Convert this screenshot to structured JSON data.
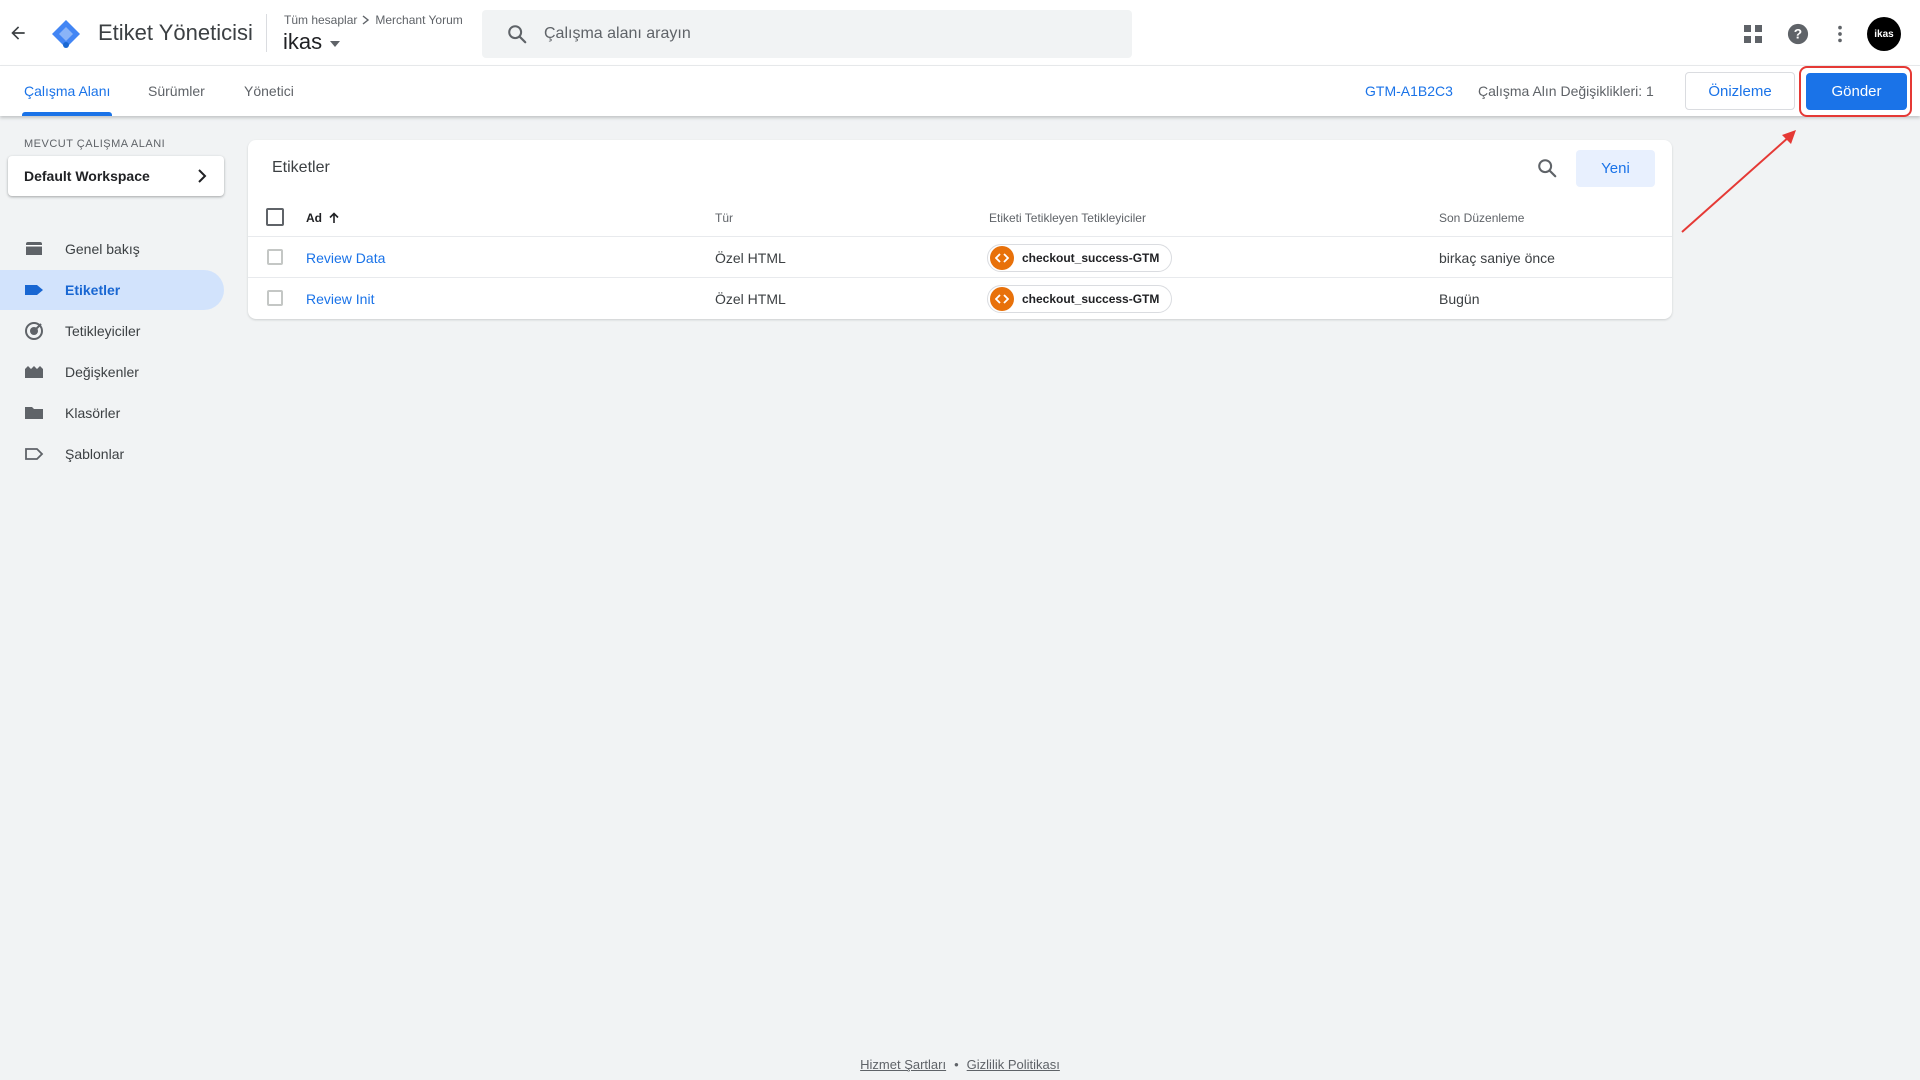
{
  "header": {
    "app_title": "Etiket Yöneticisi",
    "breadcrumb": [
      "Tüm hesaplar",
      "Merchant Yorum"
    ],
    "container_name": "ikas",
    "search_placeholder": "Çalışma alanı arayın",
    "avatar_text": "ikas"
  },
  "subnav": {
    "tabs": [
      {
        "label": "Çalışma Alanı",
        "active": true
      },
      {
        "label": "Sürümler",
        "active": false
      },
      {
        "label": "Yönetici",
        "active": false
      }
    ],
    "container_id": "GTM-A1B2C3",
    "changes_label": "Çalışma Alın Değişiklikleri: 1",
    "preview_label": "Önizleme",
    "submit_label": "Gönder"
  },
  "sidebar": {
    "workspace_label": "MEVCUT ÇALIŞMA ALANI",
    "workspace_name": "Default Workspace",
    "items": [
      {
        "label": "Genel bakış",
        "icon": "overview-icon",
        "active": false
      },
      {
        "label": "Etiketler",
        "icon": "tag-icon",
        "active": true
      },
      {
        "label": "Tetikleyiciler",
        "icon": "trigger-icon",
        "active": false
      },
      {
        "label": "Değişkenler",
        "icon": "variables-icon",
        "active": false
      },
      {
        "label": "Klasörler",
        "icon": "folder-icon",
        "active": false
      },
      {
        "label": "Şablonlar",
        "icon": "template-icon",
        "active": false
      }
    ]
  },
  "tags_table": {
    "title": "Etiketler",
    "new_label": "Yeni",
    "columns": [
      "Ad",
      "Tür",
      "Etiketi Tetikleyen Tetikleyiciler",
      "Son Düzenleme"
    ],
    "rows": [
      {
        "name": "Review Data",
        "type": "Özel HTML",
        "trigger": "checkout_success-GTM",
        "edited": "birkaç saniye önce"
      },
      {
        "name": "Review Init",
        "type": "Özel HTML",
        "trigger": "checkout_success-GTM",
        "edited": "Bugün"
      }
    ]
  },
  "footer": {
    "terms": "Hizmet Şartları",
    "separator": "•",
    "privacy": "Gizlilik Politikası"
  },
  "colors": {
    "accent": "#1a73e8",
    "active_nav_bg": "#d2e3fc",
    "trigger_orange": "#e8710a",
    "annotation_red": "#e53935"
  }
}
